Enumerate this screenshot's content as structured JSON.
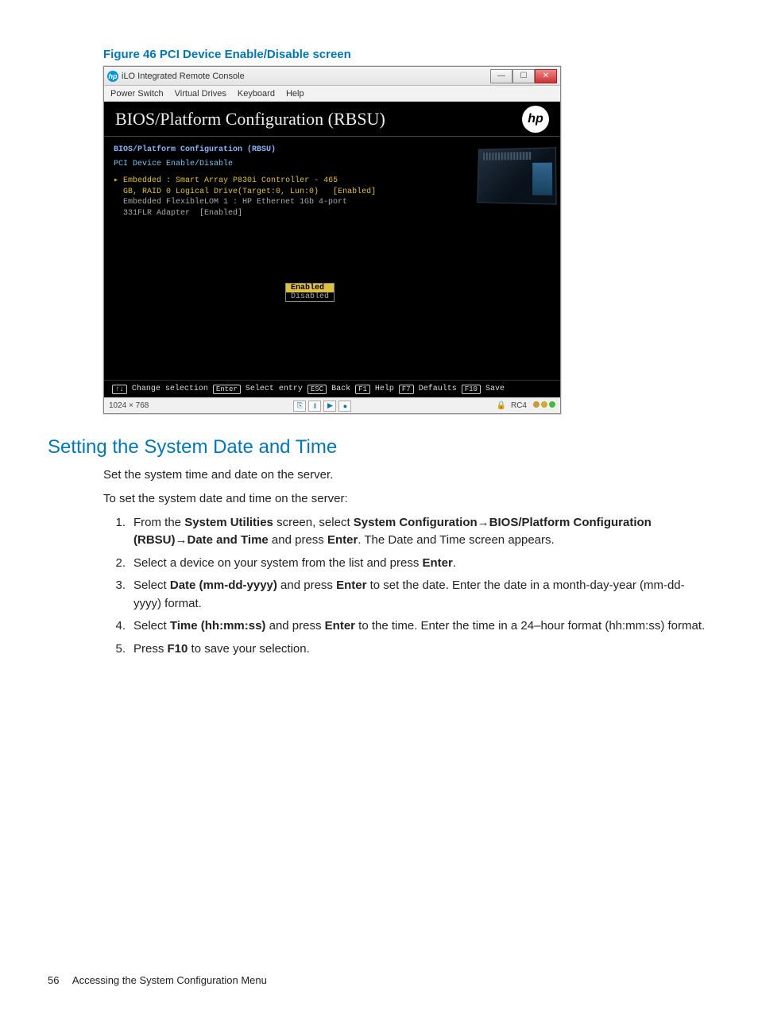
{
  "figure": {
    "caption": "Figure 46 PCI Device Enable/Disable screen"
  },
  "window": {
    "title": "iLO Integrated Remote Console",
    "menu": [
      "Power Switch",
      "Virtual Drives",
      "Keyboard",
      "Help"
    ]
  },
  "bios": {
    "header": "BIOS/Platform Configuration (RBSU)",
    "logo": "hp",
    "breadcrumb1": "BIOS/Platform Configuration (RBSU)",
    "breadcrumb2": "PCI Device Enable/Disable",
    "devices": [
      {
        "label": "Embedded : Smart Array P830i Controller - 465\n  GB, RAID 0 Logical Drive(Target:0, Lun:0)",
        "state": "[Enabled]",
        "selected": true
      },
      {
        "label": "Embedded FlexibleLOM 1 : HP Ethernet 1Gb 4-port\n  331FLR Adapter",
        "state": "[Enabled]",
        "selected": false
      }
    ],
    "popup": {
      "options": [
        "Enabled",
        "Disabled"
      ],
      "selected": 0
    },
    "keys": [
      {
        "k": "↑↓",
        "t": "Change selection"
      },
      {
        "k": "Enter",
        "t": "Select entry"
      },
      {
        "k": "ESC",
        "t": "Back"
      },
      {
        "k": "F1",
        "t": "Help"
      },
      {
        "k": "F7",
        "t": "Defaults"
      },
      {
        "k": "F10",
        "t": "Save"
      }
    ]
  },
  "status": {
    "resolution": "1024 × 768",
    "buttons": [
      "⎘",
      "‖",
      "▶",
      "●"
    ],
    "enc": "RC4"
  },
  "section_title": "Setting the System Date and Time",
  "intro1": "Set the system time and date on the server.",
  "intro2": "To set the system date and time on the server:",
  "steps": {
    "s1a": "From the ",
    "s1b": "System Utilities",
    "s1c": " screen, select ",
    "s1d": "System Configuration",
    "s1e": "→",
    "s1f": "BIOS/Platform Configuration (RBSU)",
    "s1g": "→",
    "s1h": "Date and Time",
    "s1i": " and press ",
    "s1j": "Enter",
    "s1k": ". The Date and Time screen appears.",
    "s2a": "Select a device on your system from the list and press ",
    "s2b": "Enter",
    "s2c": ".",
    "s3a": "Select ",
    "s3b": "Date (mm-dd-yyyy)",
    "s3c": " and press ",
    "s3d": "Enter",
    "s3e": " to set the date. Enter the date in a month-day-year (mm-dd-yyyy) format.",
    "s4a": "Select ",
    "s4b": "Time (hh:mm:ss)",
    "s4c": " and press ",
    "s4d": "Enter",
    "s4e": " to the time. Enter the time in a 24–hour format (hh:mm:ss) format.",
    "s5a": "Press ",
    "s5b": "F10",
    "s5c": " to save your selection."
  },
  "footer": {
    "page": "56",
    "chapter": "Accessing the System Configuration Menu"
  }
}
